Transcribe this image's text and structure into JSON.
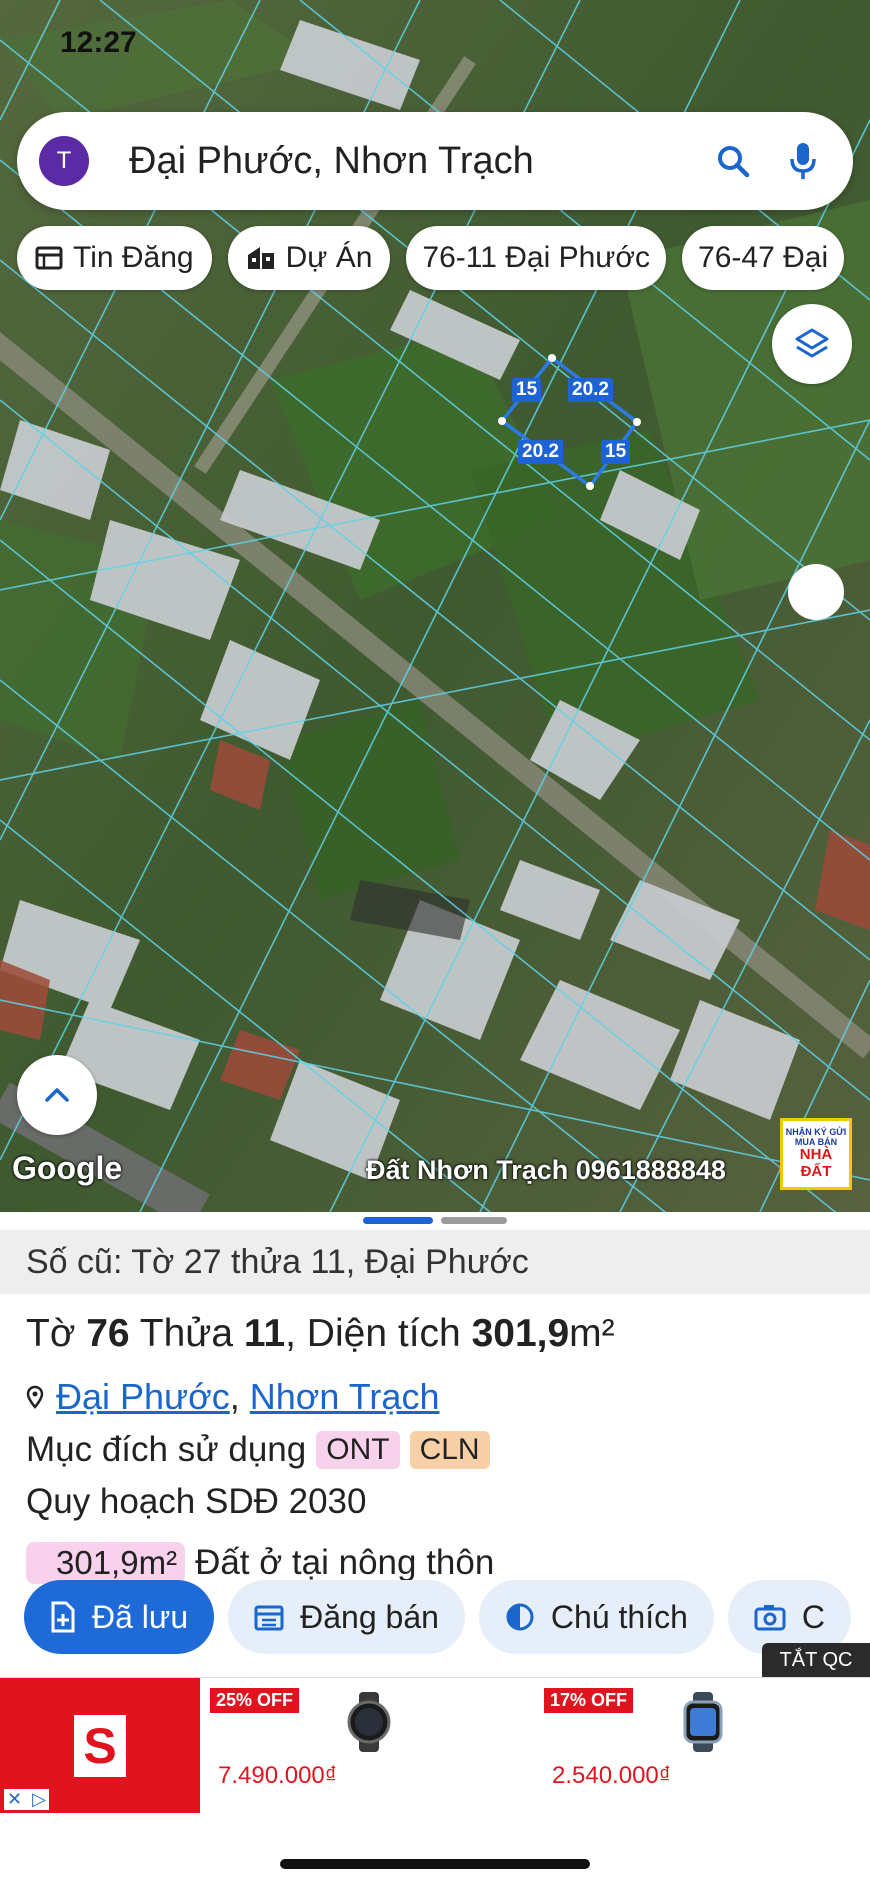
{
  "status": {
    "time": "12:27",
    "right": ""
  },
  "search": {
    "avatar_letter": "T",
    "text": "Đại Phước, Nhơn Trạch"
  },
  "chips": [
    {
      "label": "Tin Đăng",
      "icon": "listing-icon"
    },
    {
      "label": "Dự Án",
      "icon": "building-icon"
    },
    {
      "label": "76-11 Đại Phước",
      "icon": ""
    },
    {
      "label": "76-47 Đại",
      "icon": ""
    }
  ],
  "parcel": {
    "edges": [
      "15",
      "20.2",
      "20.2",
      "15"
    ]
  },
  "map": {
    "google": "Google",
    "watermark": "Đất Nhơn Trạch 0961888848",
    "stamp_small": "NHẬN KÝ GỬI MUA BÁN",
    "stamp_big": "NHÀ ĐẤT"
  },
  "sheet": {
    "old_number": "Số cũ: Tờ 27 thửa 11, Đại Phước",
    "title_prefix": "Tờ ",
    "sheet_no": "76",
    "title_mid": " Thửa ",
    "plot_no": "11",
    "title_area_label": ", Diện tích ",
    "area": "301,9",
    "area_unit": "m²",
    "ward": "Đại Phước",
    "district": "Nhơn Trạch",
    "purpose_label": "Mục đích sử dụng",
    "purpose_codes": [
      "ONT",
      "CLN"
    ],
    "plan_label": "Quy hoạch SDĐ 2030",
    "land_area": "301,9m²",
    "land_type": "Đất ở tại nông thôn"
  },
  "actions": [
    {
      "label": "Đã lưu"
    },
    {
      "label": "Đăng bán"
    },
    {
      "label": "Chú thích"
    },
    {
      "label": "C"
    }
  ],
  "ad": {
    "close_label": "TẮT QC",
    "offers": [
      {
        "discount": "25% OFF",
        "price": "7.490.000₫"
      },
      {
        "discount": "17% OFF",
        "price": "2.540.000₫"
      }
    ]
  },
  "colors": {
    "accent": "#1e6ad6",
    "cadastral_line": "#5fd3e8",
    "badge_ont": "#f8d2ec",
    "badge_cln": "#f8d0a8",
    "ad_red": "#e0141e"
  }
}
